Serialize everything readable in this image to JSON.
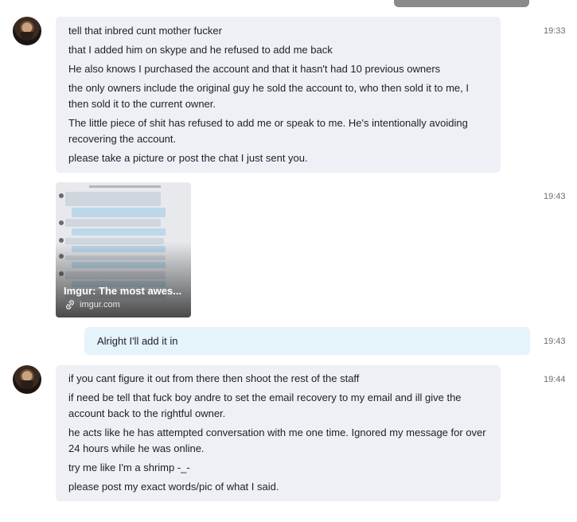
{
  "conversation": {
    "groups": [
      {
        "time": "19:33",
        "lines": [
          "tell that inbred cunt mother fucker",
          "that I added him on skype and he refused to add me back",
          "He also knows I purchased the account and that it hasn't had 10 previous owners",
          "the only owners include the original guy he sold the account to, who then sold it to me, I then sold it to the current owner.",
          "The little piece of shit has refused to add me or speak to me. He's intentionally avoiding recovering the account.",
          "please take a picture or post the chat I just sent you."
        ]
      },
      {
        "time": "19:43",
        "link_preview": {
          "title": "Imgur: The most awes...",
          "domain": "imgur.com",
          "icon": "link-icon"
        }
      },
      {
        "time": "19:43",
        "lines": [
          "Alright I'll add it in"
        ]
      },
      {
        "time": "19:44",
        "lines": [
          "if you cant figure it out from there then shoot the rest of the staff",
          "if need be tell that fuck boy andre to set the email recovery to my email and ill give the account back to the rightful owner.",
          "he acts like he has attempted conversation with me one time. Ignored my message for over 24 hours while he was online.",
          "try me like I'm a shrimp -_-",
          "please post my exact words/pic of what I said."
        ]
      }
    ]
  },
  "colors": {
    "incoming_bubble": "#eef0f5",
    "outgoing_bubble": "#e5f3fb",
    "timestamp": "#6e6e6e"
  }
}
